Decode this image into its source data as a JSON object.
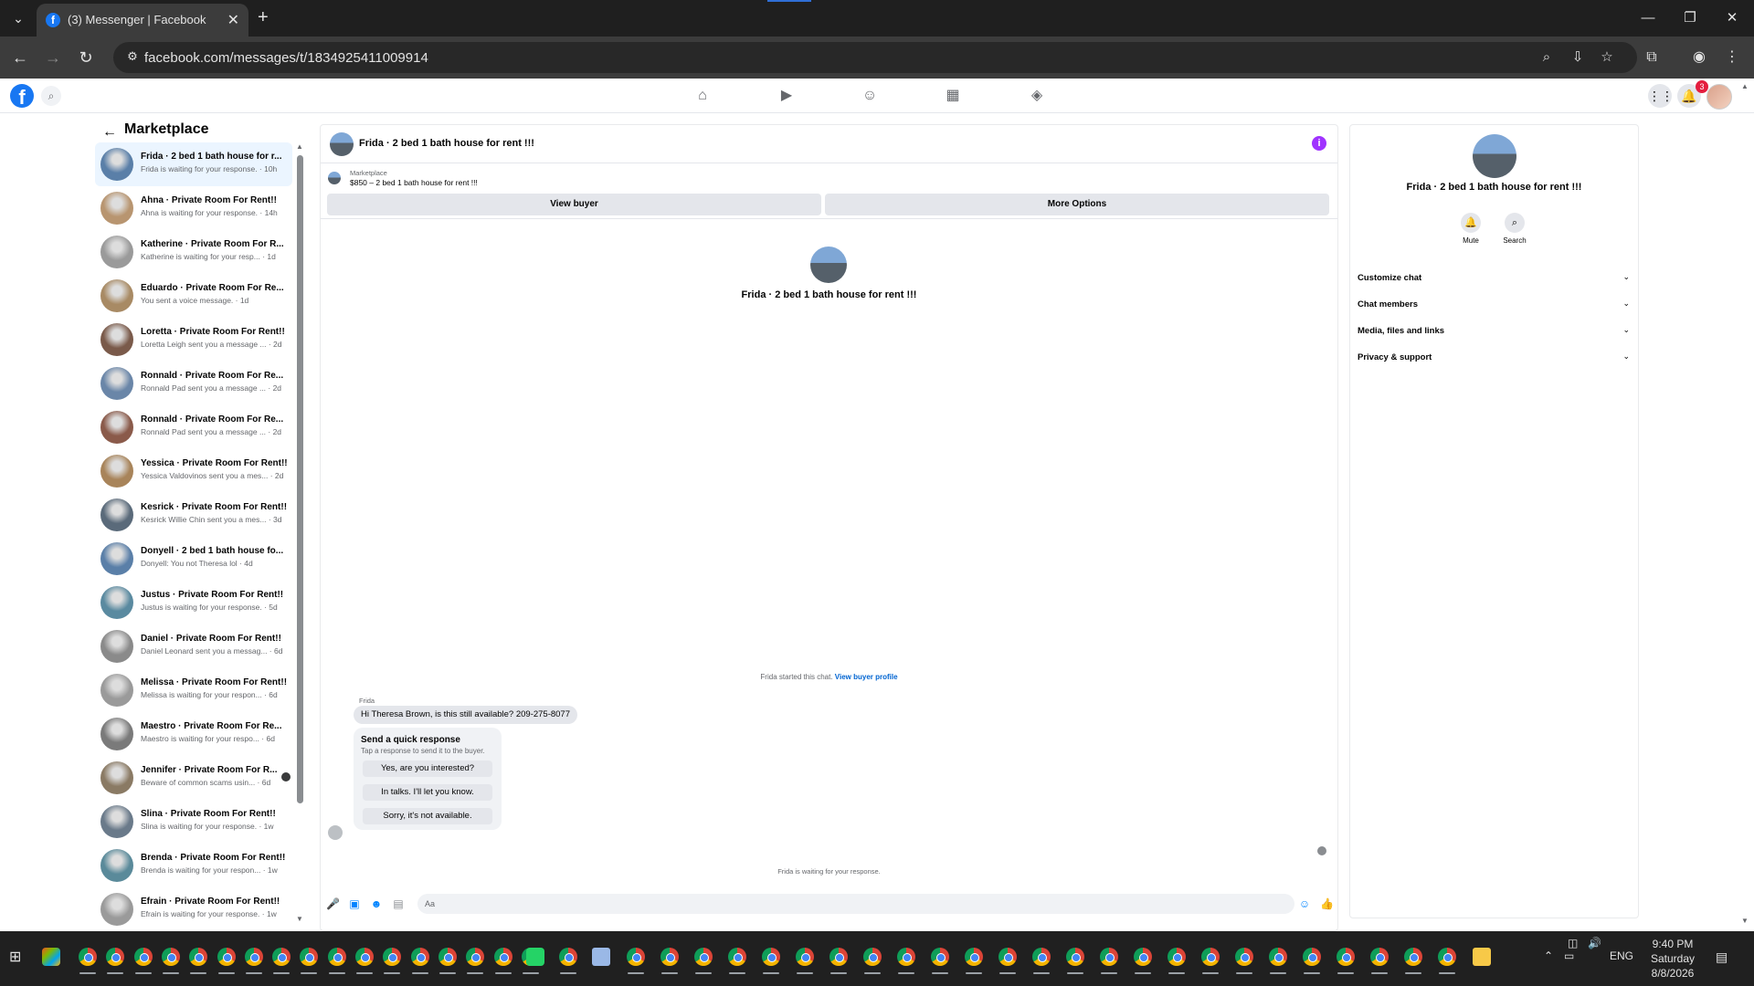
{
  "browser": {
    "tab_title": "(3) Messenger | Facebook",
    "tab_close": "✕",
    "new_tab": "+",
    "url": "facebook.com/messages/t/1834925411009914"
  },
  "fbnav": {
    "notification_count": "3"
  },
  "sidebar": {
    "title": "Marketplace",
    "conversations": [
      {
        "name": "Frida · 2 bed 1 bath house for r...",
        "sub": "Frida is waiting for your response. · 10h",
        "color": "#5a7fa8"
      },
      {
        "name": "Ahna · Private Room For Rent!!",
        "sub": "Ahna is waiting for your response. · 14h",
        "color": "#b89570"
      },
      {
        "name": "Katherine · Private Room For R...",
        "sub": "Katherine is waiting for your resp... · 1d",
        "color": "#9a9a9a"
      },
      {
        "name": "Eduardo · Private Room For Re...",
        "sub": "You sent a voice message. · 1d",
        "color": "#a88a64"
      },
      {
        "name": "Loretta · Private Room For Rent!!",
        "sub": "Loretta Leigh sent you a message ... · 2d",
        "color": "#7a5a4a"
      },
      {
        "name": "Ronnald · Private Room For Re...",
        "sub": "Ronnald Pad sent you a message ... · 2d",
        "color": "#6a86a8"
      },
      {
        "name": "Ronnald · Private Room For Re...",
        "sub": "Ronnald Pad sent you a message ... · 2d",
        "color": "#8a5a4a"
      },
      {
        "name": "Yessica · Private Room For Rent!!",
        "sub": "Yessica Valdovinos sent you a mes... · 2d",
        "color": "#a8845a"
      },
      {
        "name": "Kesrick · Private Room For Rent!!",
        "sub": "Kesrick Willie Chin sent you a mes... · 3d",
        "color": "#5a6a7a"
      },
      {
        "name": "Donyell · 2 bed 1 bath house fo...",
        "sub": "Donyell: You not Theresa lol · 4d",
        "color": "#5a7fa8"
      },
      {
        "name": "Justus · Private Room For Rent!!",
        "sub": "Justus is waiting for your response. · 5d",
        "color": "#5a8aa0"
      },
      {
        "name": "Daniel · Private Room For Rent!!",
        "sub": "Daniel Leonard sent you a messag... · 6d",
        "color": "#8a8a8a"
      },
      {
        "name": "Melissa · Private Room For Rent!!",
        "sub": "Melissa is waiting for your respon... · 6d",
        "color": "#9a9a9a"
      },
      {
        "name": "Maestro · Private Room For Re...",
        "sub": "Maestro is waiting for your respo... · 6d",
        "color": "#7a7a7a"
      },
      {
        "name": "Jennifer · Private Room For R...",
        "sub": "Beware of common scams usin... · 6d",
        "color": "#8a7a64",
        "dot": true
      },
      {
        "name": "Slina · Private Room For Rent!!",
        "sub": "Slina is waiting for your response. · 1w",
        "color": "#6a7a8a"
      },
      {
        "name": "Brenda · Private Room For Rent!!",
        "sub": "Brenda is waiting for your respon... · 1w",
        "color": "#5a8a9a"
      },
      {
        "name": "Efrain · Private Room For Rent!!",
        "sub": "Efrain is waiting for your response. · 1w",
        "color": "#9a9a9a"
      }
    ]
  },
  "chat": {
    "title": "Frida · 2 bed 1 bath house for rent !!!",
    "info_icon": "i",
    "marketplace_label": "Marketplace",
    "listing": "$850 – 2 bed 1 bath house for rent !!!",
    "view_buyer": "View buyer",
    "more_options": "More Options",
    "intro_name": "Frida · 2 bed 1 bath house for rent !!!",
    "started_text": "Frida started this chat. ",
    "view_buyer_profile": "View buyer profile",
    "sender": "Frida",
    "message": "Hi Theresa Brown, is this still available? 209-275-8077",
    "quick_title": "Send a quick response",
    "quick_sub": "Tap a response to send it to the buyer.",
    "quick_responses": [
      "Yes, are you interested?",
      "In talks. I'll let you know.",
      "Sorry, it's not available."
    ],
    "waiting": "Frida is waiting for your response.",
    "composer_placeholder": "Aa"
  },
  "details": {
    "name": "Frida · 2 bed 1 bath house for rent !!!",
    "mute_label": "Mute",
    "search_label": "Search",
    "sections": [
      "Customize chat",
      "Chat members",
      "Media, files and links",
      "Privacy & support"
    ]
  },
  "taskbar": {
    "language": "ENG",
    "time": "9:40 PM",
    "day": "Saturday",
    "date": "8/8/2026"
  },
  "colors": {
    "fb_blue": "#1877f2",
    "active_conv": "#ebf5ff",
    "info_purple": "#a033ff",
    "link_blue": "#0064d1",
    "messenger_blue": "#0084ff"
  }
}
